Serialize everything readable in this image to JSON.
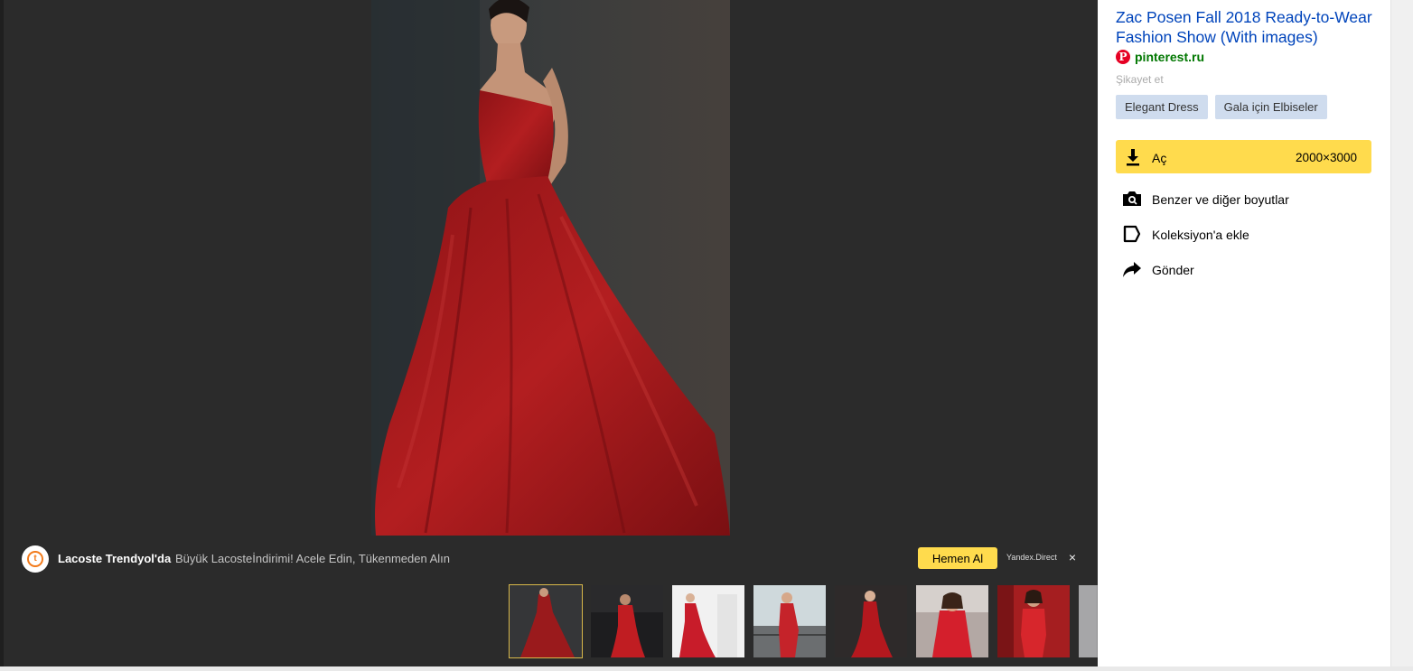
{
  "ad": {
    "brand": "Lacoste Trendyol'da",
    "text": "Büyük Lacosteİndirimi! Acele Edin, Tükenmeden Alın",
    "cta": "Hemen Al",
    "source": "Yandex.Direct",
    "close": "×",
    "logo_glyph": "t"
  },
  "panel": {
    "title": "Zac Posen Fall 2018 Ready-to-Wear Fashion Show (With images)",
    "source_icon": "pinterest-icon",
    "source_glyph": "P",
    "source": "pinterest.ru",
    "report": "Şikayet et",
    "tags": [
      "Elegant Dress",
      "Gala için Elbiseler"
    ],
    "open_button": {
      "label": "Aç",
      "size": "2000×3000"
    },
    "actions": [
      {
        "label": "Benzer ve diğer boyutlar",
        "icon": "camera-search-icon"
      },
      {
        "label": "Koleksiyon'a ekle",
        "icon": "collection-icon"
      },
      {
        "label": "Gönder",
        "icon": "share-arrow-icon"
      }
    ]
  },
  "thumbnails": {
    "count": 8,
    "active_index": 0
  },
  "colors": {
    "viewer_bg": "#2b2b2b",
    "accent_yellow": "#ffdb4d",
    "link_blue": "#0044bb",
    "source_green": "#007700",
    "tag_bg": "#cfdcee",
    "dress_red": "#a3181c"
  }
}
